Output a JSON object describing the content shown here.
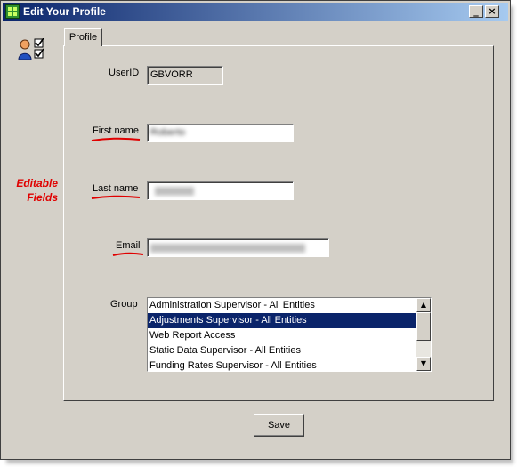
{
  "window": {
    "title": "Edit Your Profile",
    "minimize_glyph": "_",
    "close_glyph": "×"
  },
  "annotation": {
    "editable_fields": "Editable Fields",
    "underline_color": "#e00000"
  },
  "tabs": [
    {
      "label": "Profile",
      "active": true
    }
  ],
  "form": {
    "userid": {
      "label": "UserID",
      "value": "GBVORR"
    },
    "first_name": {
      "label": "First name",
      "value": "Roberto"
    },
    "last_name": {
      "label": "Last name",
      "value": ""
    },
    "email": {
      "label": "Email",
      "value": ""
    },
    "group": {
      "label": "Group",
      "options": [
        "Administration Supervisor - All Entities",
        "Adjustments Supervisor - All Entities",
        "Web Report Access",
        "Static Data Supervisor - All Entities",
        "Funding Rates Supervisor - All Entities"
      ],
      "selected_index": 1
    }
  },
  "actions": {
    "save_label": "Save"
  },
  "icons": {
    "app": "app-grid-icon",
    "user": "user-checklist-icon",
    "scroll_up": "scroll-up-arrow-icon",
    "scroll_down": "scroll-down-arrow-icon"
  },
  "colors": {
    "titlebar_start": "#0a246a",
    "titlebar_end": "#a6caf0",
    "window_bg": "#d4d0c8",
    "selection": "#0a246a",
    "annotation_red": "#e00000"
  }
}
